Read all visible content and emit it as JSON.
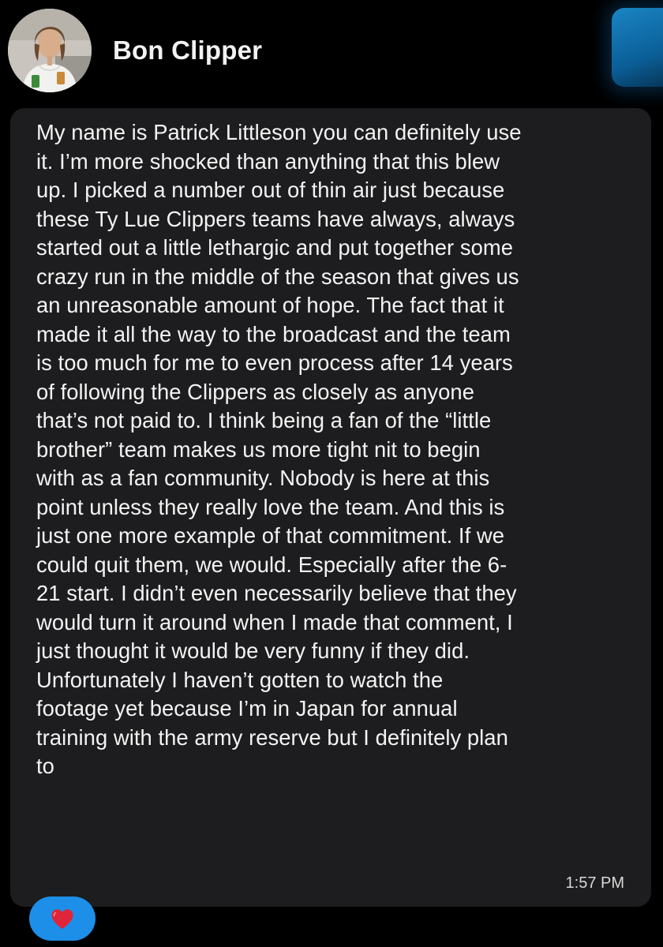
{
  "sender": {
    "name": "Bon Clipper"
  },
  "message": {
    "text": "My name is Patrick  Littleson you can definitely use\nit. I’m more shocked than anything that this blew\nup. I picked a number out of thin air just because\nthese Ty Lue Clippers teams have always, always\nstarted out a little lethargic and put together some\ncrazy run in the middle of the season that gives us\nan unreasonable amount of hope. The fact that it\nmade it all the way to the broadcast and the team\nis too much for me to even process after 14 years\nof following the Clippers as closely as anyone\nthat’s not paid to. I think being a fan of the “little\nbrother” team makes us more tight nit to begin\nwith as a fan community. Nobody is here at this\npoint unless they really love the team. And this is\njust one more example of that commitment. If we\ncould quit them, we would. Especially after the 6-\n21 start. I didn’t even necessarily believe that they\nwould turn it around when I made that comment, I\njust thought it would be very funny if they did.\nUnfortunately I haven’t gotten to watch the\nfootage yet because I’m in Japan for annual\ntraining with the army reserve but I definitely plan\nto",
    "timestamp": "1:57 PM"
  },
  "reaction": {
    "icon": "heart-icon",
    "color": "#e0243a",
    "background": "#1d8fe8"
  },
  "colors": {
    "background": "#000000",
    "bubble": "#1d1d1f",
    "text": "#f3f3f3"
  }
}
